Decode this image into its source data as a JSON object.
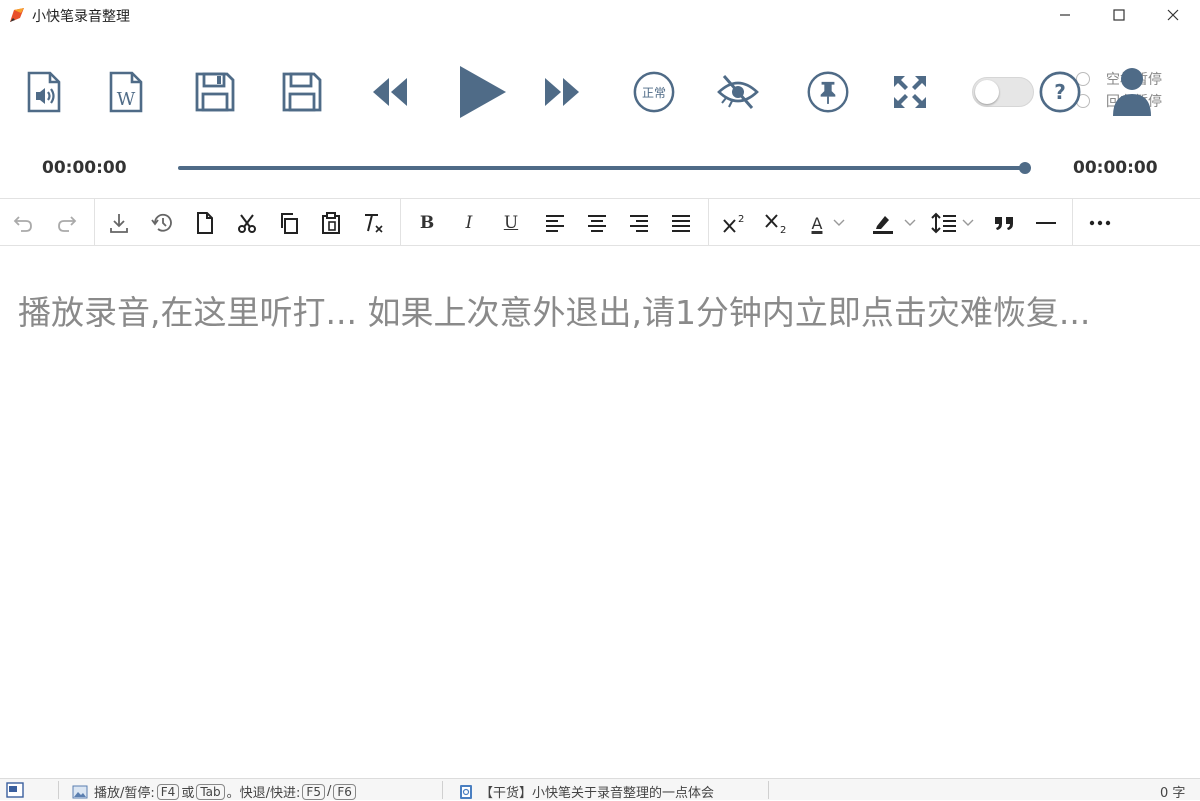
{
  "window": {
    "title": "小快笔录音整理",
    "logo_icon": "app-logo-icon",
    "buttons": {
      "minimize": "minimize-icon",
      "maximize": "maximize-icon",
      "close": "close-icon"
    }
  },
  "player": {
    "buttons": [
      {
        "name": "open-audio-button",
        "icon": "audio-file-icon"
      },
      {
        "name": "open-word-button",
        "icon": "word-file-icon"
      },
      {
        "name": "save-button",
        "icon": "save-icon"
      },
      {
        "name": "save-as-button",
        "icon": "save-as-icon"
      },
      {
        "name": "rewind-button",
        "icon": "rewind-icon"
      },
      {
        "name": "play-button",
        "icon": "play-icon"
      },
      {
        "name": "fast-forward-button",
        "icon": "fast-forward-icon"
      },
      {
        "name": "speed-button",
        "icon": "speed-normal-icon",
        "label": "正常"
      },
      {
        "name": "hide-button",
        "icon": "eye-off-icon"
      },
      {
        "name": "pin-button",
        "icon": "pin-icon"
      },
      {
        "name": "fullscreen-button",
        "icon": "fullscreen-icon"
      },
      {
        "name": "help-button",
        "icon": "help-icon",
        "label": "?"
      }
    ],
    "toggle_on": false,
    "radio_options": [
      "空格暂停",
      "回车暂停"
    ],
    "time_elapsed": "00:00:00",
    "time_total": "00:00:00",
    "progress": 1.0,
    "accent_color": "#4f6b87"
  },
  "editor_toolbar": {
    "groups": [
      [
        "undo-icon",
        "redo-icon"
      ],
      [
        "download-icon",
        "history-icon",
        "new-document-icon",
        "cut-icon",
        "copy-icon",
        "paste-icon",
        "clear-format-icon"
      ],
      [
        "bold-icon",
        "italic-icon",
        "underline-icon",
        "align-left-icon",
        "align-center-icon",
        "align-right-icon",
        "align-justify-icon"
      ],
      [
        "superscript-icon",
        "subscript-icon",
        "font-color-icon",
        "highlight-icon",
        "line-height-icon",
        "quote-icon",
        "horizontal-rule-icon"
      ],
      [
        "more-icon"
      ]
    ],
    "labels": {
      "bold": "B",
      "italic": "I",
      "underline": "U",
      "font_color": "A"
    }
  },
  "editor": {
    "placeholder": "播放录音,在这里听打... 如果上次意外退出,请1分钟内立即点击灾难恢复..."
  },
  "statusbar": {
    "shortcut_label": "播放/暂停:",
    "key_f4": "F4",
    "or_text": "或",
    "key_tab": "Tab",
    "seek_label": "。快退/快进:",
    "key_f5": "F5",
    "slash": "/",
    "key_f6": "F6",
    "article_link": "【干货】小快笔关于录音整理的一点体会",
    "word_count": "0 字"
  }
}
